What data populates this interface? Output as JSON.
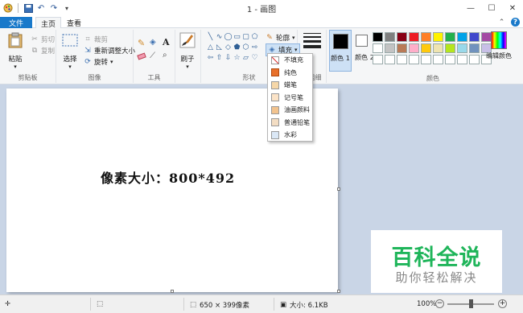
{
  "window": {
    "title": "1 - 画图",
    "qat_dropdown_glyph": "▾",
    "controls": {
      "minimize": "—",
      "maximize": "☐",
      "close": "✕"
    }
  },
  "tabs": {
    "file": "文件",
    "home": "主页",
    "view": "查看",
    "help_glyph": "?"
  },
  "ribbon": {
    "clipboard": {
      "label": "剪贴板",
      "paste": "粘贴",
      "cut": "剪切",
      "copy": "复制"
    },
    "image": {
      "label": "图像",
      "select": "选择",
      "crop": "裁剪",
      "resize": "重新调整大小",
      "rotate": "旋转"
    },
    "tools": {
      "label": "工具",
      "text_tool": "A"
    },
    "brushes": {
      "label": "刷子"
    },
    "shapes": {
      "label": "形状",
      "outline": "轮廓",
      "fill": "填充"
    },
    "size": {
      "label": "粗细"
    },
    "colors": {
      "label": "颜色",
      "color1": "颜色 1",
      "color2": "颜色 2",
      "edit": "编辑颜色",
      "palette": [
        "#000000",
        "#7f7f7f",
        "#880015",
        "#ed1c24",
        "#ff7f27",
        "#fff200",
        "#22b14c",
        "#00a2e8",
        "#3f48cc",
        "#a349a4",
        "#ffffff",
        "#c3c3c3",
        "#b97a57",
        "#ffaec9",
        "#ffc90e",
        "#efe4b0",
        "#b5e61d",
        "#99d9ea",
        "#7092be",
        "#c8bfe7",
        "#ffffff",
        "#ffffff",
        "#ffffff",
        "#ffffff",
        "#ffffff",
        "#ffffff",
        "#ffffff",
        "#ffffff",
        "#ffffff",
        "#ffffff"
      ]
    }
  },
  "fill_menu": {
    "items": [
      "不填充",
      "纯色",
      "蜡笔",
      "记号笔",
      "油画颜料",
      "普通铅笔",
      "水彩"
    ]
  },
  "canvas": {
    "text": "像素大小：800*492"
  },
  "watermark": {
    "title": "百科全说",
    "subtitle": "助你轻松解决"
  },
  "statusbar": {
    "dimensions": "650 × 399像素",
    "filesize": "大小: 6.1KB",
    "zoom": "100%",
    "zoom_minus": "−",
    "zoom_plus": "+"
  }
}
